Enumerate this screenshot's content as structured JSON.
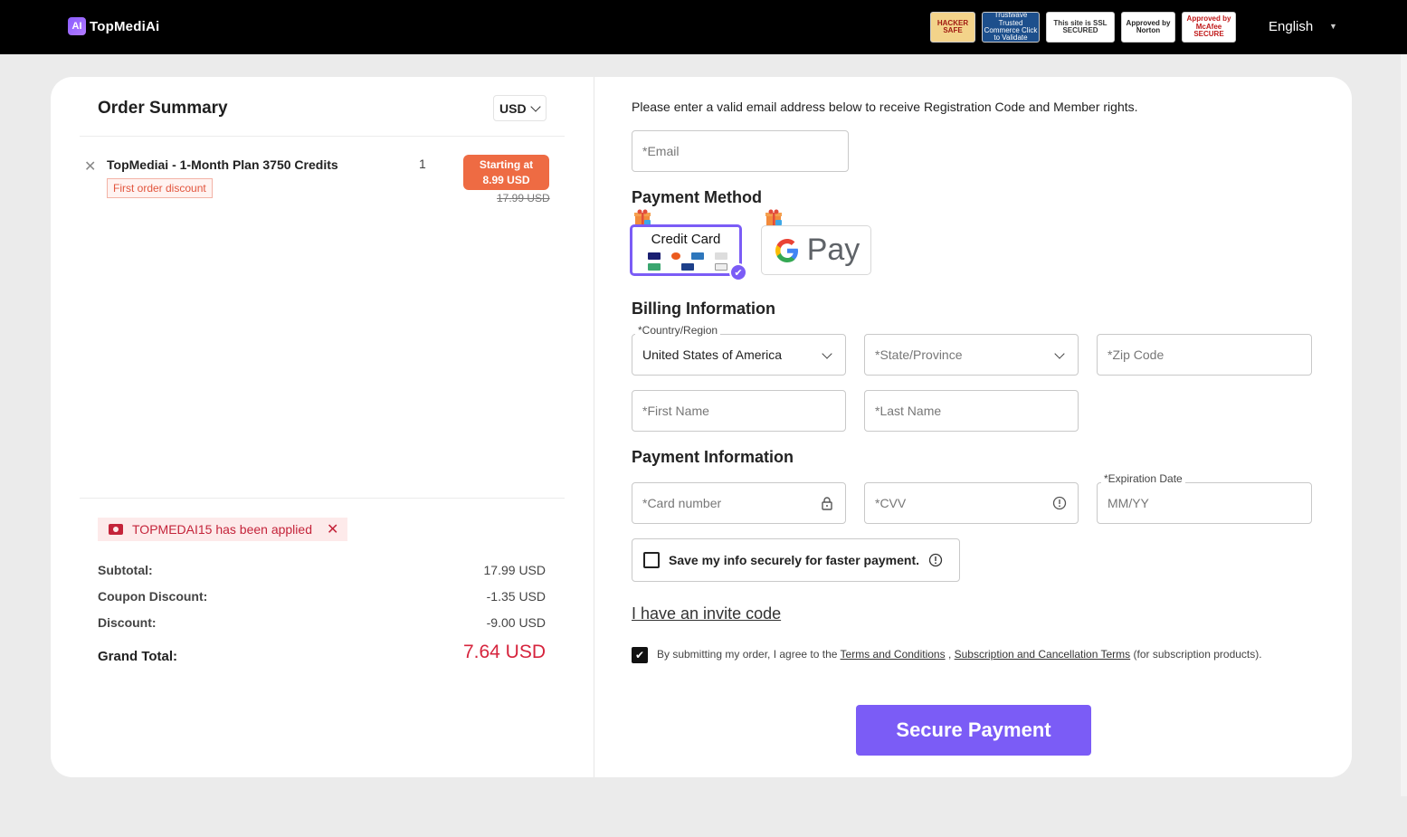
{
  "header": {
    "brand": "TopMediAi",
    "logo_mark": "AI",
    "badges": [
      "HACKER SAFE",
      "Trustwave Trusted Commerce Click to Validate",
      "This site is SSL SECURED",
      "Approved by Norton",
      "Approved by McAfee SECURE"
    ],
    "language": "English"
  },
  "order_summary": {
    "title": "Order Summary",
    "currency": "USD",
    "item": {
      "name": "TopMediai - 1-Month Plan 3750 Credits",
      "tag": "First order discount",
      "quantity": "1",
      "price_line1": "Starting at",
      "price_line2": "8.99 USD",
      "old_price": "17.99 USD"
    },
    "coupon_text": "TOPMEDAI15 has been applied",
    "totals": {
      "subtotal_label": "Subtotal:",
      "subtotal_value": "17.99 USD",
      "coupon_label": "Coupon Discount:",
      "coupon_value": "-1.35 USD",
      "discount_label": "Discount:",
      "discount_value": "-9.00 USD",
      "grand_label": "Grand Total:",
      "grand_value": "7.64 USD"
    }
  },
  "form": {
    "intro": "Please enter a valid email address below to receive Registration Code and Member rights.",
    "email_placeholder": "*Email",
    "payment_method_title": "Payment Method",
    "credit_card_label": "Credit Card",
    "gpay_label": "Pay",
    "billing_title": "Billing Information",
    "country_label": "*Country/Region",
    "country_value": "United States of America",
    "state_placeholder": "*State/Province",
    "zip_placeholder": "*Zip Code",
    "first_name_placeholder": "*First Name",
    "last_name_placeholder": "*Last Name",
    "payment_info_title": "Payment Information",
    "card_number_placeholder": "*Card number",
    "cvv_placeholder": "*CVV",
    "expiry_label": "*Expiration Date",
    "expiry_placeholder": "MM/YY",
    "save_info_label": "Save my info securely for faster payment.",
    "invite_code_link": "I have an invite code",
    "agree_prefix": "By submitting my order, I agree to the ",
    "terms_link": "Terms and Conditions",
    "agree_sep": " , ",
    "subscription_link": "Subscription and Cancellation Terms",
    "agree_suffix": " (for subscription products).",
    "submit_label": "Secure Payment"
  },
  "colors": {
    "accent": "#7b5cf6",
    "price_pill": "#ee6b43",
    "grand_total": "#d6243d",
    "coupon_bg": "#fdeaea"
  }
}
